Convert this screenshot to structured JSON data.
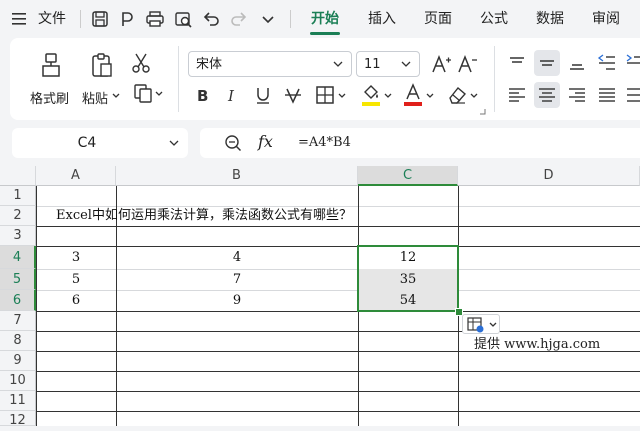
{
  "menubar": {
    "file_label": "文件",
    "tabs": [
      "开始",
      "插入",
      "页面",
      "公式",
      "数据",
      "审阅"
    ]
  },
  "ribbon": {
    "format_painter_label": "格式刷",
    "paste_label": "粘贴",
    "font_name": "宋体",
    "font_size": "11"
  },
  "formula_bar": {
    "name_box": "C4",
    "fx_label": "fx",
    "formula": "=A4*B4"
  },
  "sheet": {
    "columns": [
      "A",
      "B",
      "C",
      "D"
    ],
    "rows": [
      "1",
      "2",
      "3",
      "4",
      "5",
      "6",
      "7",
      "8",
      "9",
      "10",
      "11",
      "12"
    ],
    "title_text": "Excel中如何运用乘法计算，乘法函数公式有哪些？",
    "data": [
      [
        "3",
        "4",
        "12"
      ],
      [
        "5",
        "7",
        "35"
      ],
      [
        "6",
        "9",
        "54"
      ]
    ]
  },
  "watermark": "提供 www.hjga.com",
  "colors": {
    "accent": "#1b7f56",
    "selection_border": "#2e8b3a",
    "selection_fill": "#e6e6e6",
    "font_color_bar": "#e0201b",
    "highlight_bar": "#f7e600"
  }
}
